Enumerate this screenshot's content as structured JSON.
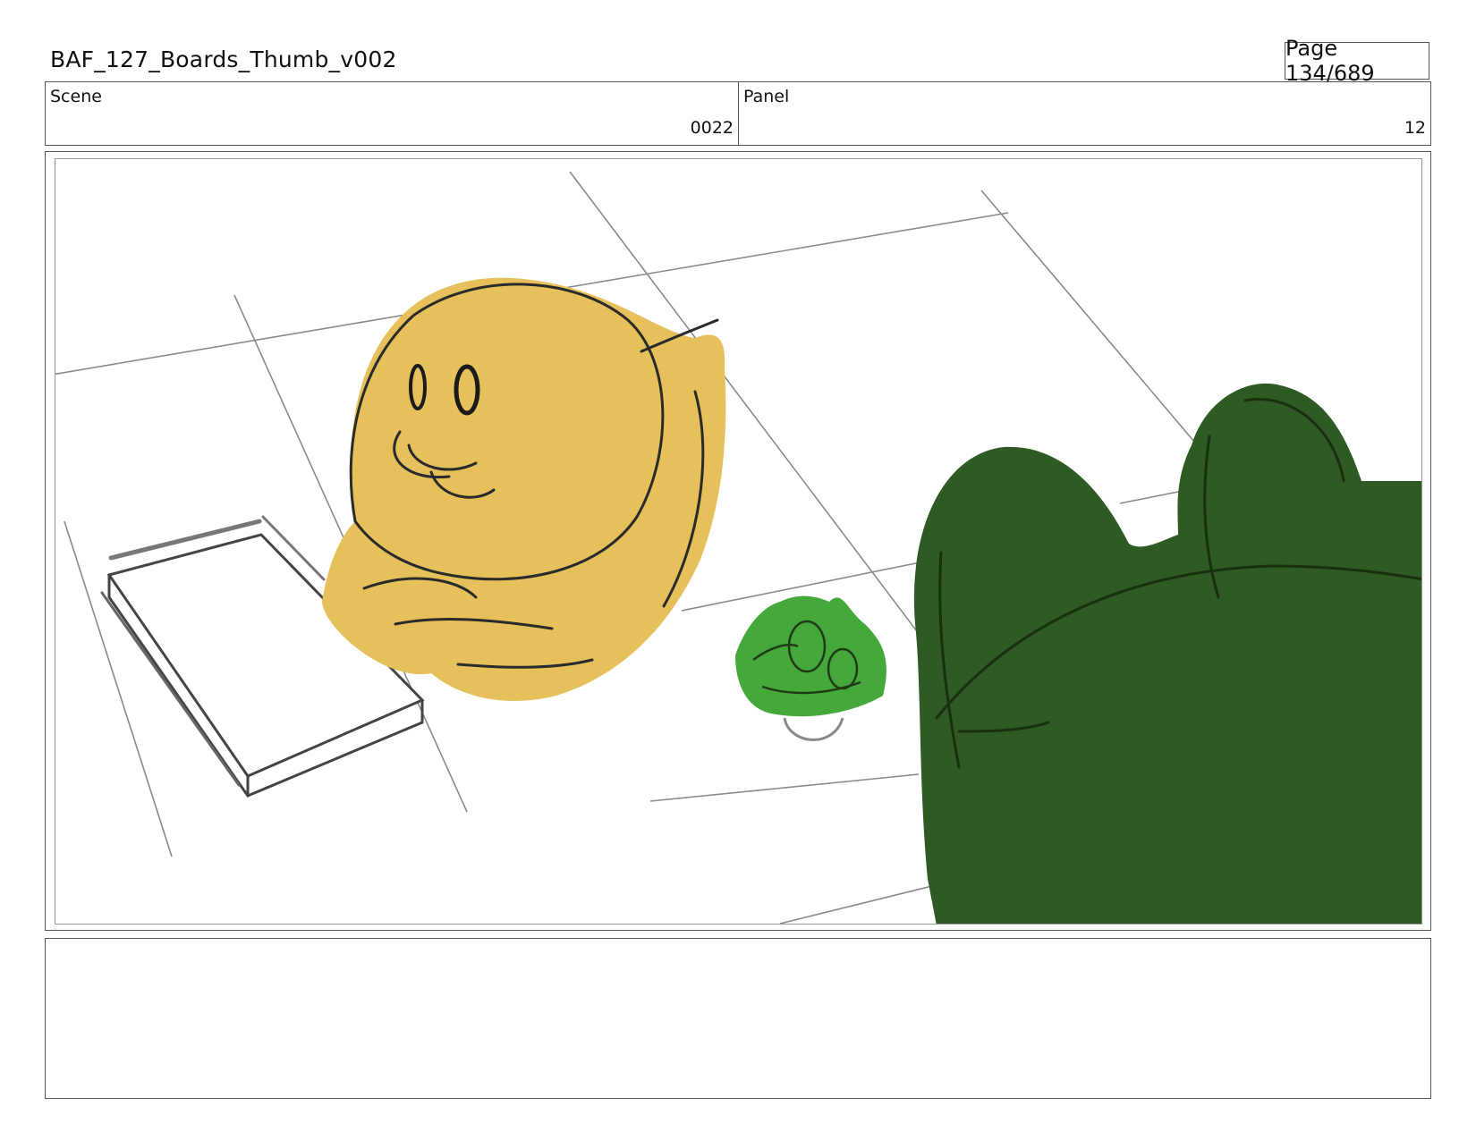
{
  "document": {
    "title": "BAF_127_Boards_Thumb_v002",
    "page": "Page 134/689"
  },
  "info": {
    "scene_label": "Scene",
    "scene_value": "0022",
    "panel_label": "Panel",
    "panel_value": "12"
  },
  "notes": {
    "text": ""
  },
  "colors": {
    "yellow_character": "#E6C05A",
    "green_small": "#45A83A",
    "green_large": "#2E5A23",
    "line": "#222222"
  }
}
